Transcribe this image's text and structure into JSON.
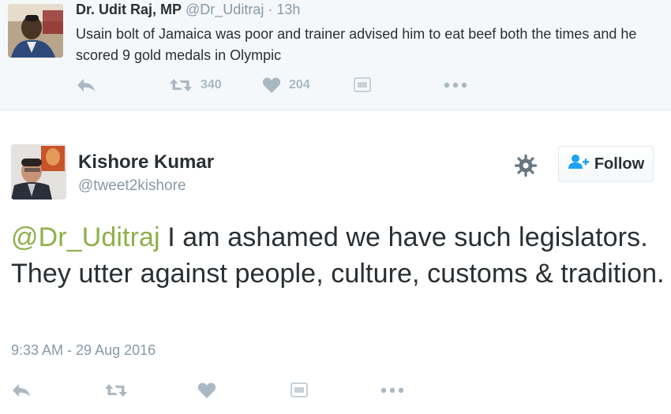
{
  "parent_tweet": {
    "author_name": "Dr. Udit Raj, MP",
    "handle": "@Dr_Uditraj",
    "separator": "·",
    "time": "13h",
    "text": "Usain bolt of Jamaica was poor and trainer advised him  to eat beef both the times and he scored 9 gold medals in Olympic",
    "retweet_count": "340",
    "like_count": "204",
    "icons": [
      "reply-icon",
      "retweet-icon",
      "like-icon",
      "moments-icon",
      "more-icon"
    ]
  },
  "main_tweet": {
    "author_name": "Kishore Kumar",
    "handle": "@tweet2kishore",
    "follow_label": "Follow",
    "mention": "@Dr_Uditraj",
    "text": " I am ashamed we have such legislators. They utter against people, culture, customs & tradition.",
    "timestamp": "9:33 AM - 29 Aug 2016",
    "icons": [
      "reply-icon",
      "retweet-icon",
      "like-icon",
      "moments-icon",
      "more-icon",
      "gear-icon",
      "follow-user-icon"
    ]
  },
  "colors": {
    "parent_background": "#f5f8fa",
    "mention": "#8fb04a",
    "muted": "#8899a6",
    "action_icon": "#aab8c2",
    "text": "#292f33"
  }
}
